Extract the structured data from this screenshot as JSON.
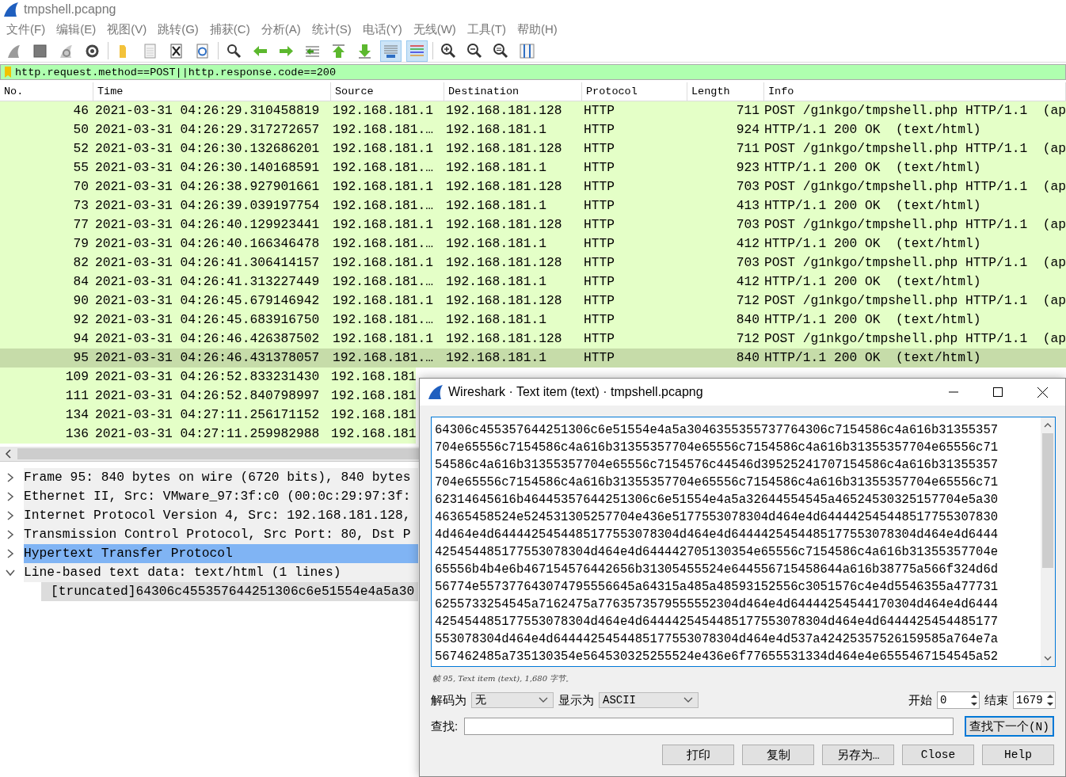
{
  "window": {
    "title": "tmpshell.pcapng"
  },
  "menu": [
    "文件(F)",
    "编辑(E)",
    "视图(V)",
    "跳转(G)",
    "捕获(C)",
    "分析(A)",
    "统计(S)",
    "电话(Y)",
    "无线(W)",
    "工具(T)",
    "帮助(H)"
  ],
  "toolbar_groups": [
    {
      "buttons": [
        {
          "kind": "fin",
          "pressed": false
        },
        {
          "kind": "stop",
          "pressed": false
        },
        {
          "kind": "restart",
          "pressed": false
        },
        {
          "kind": "options",
          "pressed": false
        }
      ]
    },
    {
      "buttons": [
        {
          "kind": "open",
          "pressed": false
        },
        {
          "kind": "file",
          "pressed": false
        },
        {
          "kind": "close",
          "pressed": false
        },
        {
          "kind": "reload",
          "pressed": false
        }
      ]
    },
    {
      "buttons": [
        {
          "kind": "find",
          "pressed": false
        },
        {
          "kind": "back",
          "pressed": false
        },
        {
          "kind": "forward",
          "pressed": false
        },
        {
          "kind": "goto",
          "pressed": false
        },
        {
          "kind": "first",
          "pressed": false
        },
        {
          "kind": "last",
          "pressed": false
        },
        {
          "kind": "autoscroll",
          "pressed": true
        },
        {
          "kind": "colorize",
          "pressed": true
        }
      ]
    },
    {
      "buttons": [
        {
          "kind": "zoom-in",
          "pressed": false
        },
        {
          "kind": "zoom-out",
          "pressed": false
        },
        {
          "kind": "zoom-normal",
          "pressed": false
        },
        {
          "kind": "resize",
          "pressed": false
        }
      ]
    }
  ],
  "filter": {
    "value": "http.request.method==POST||http.response.code==200"
  },
  "packet_list": {
    "columns": [
      "No.",
      "Time",
      "Source",
      "Destination",
      "Protocol",
      "Length",
      "Info"
    ],
    "rows": [
      {
        "cells": [
          "46",
          "2021-03-31 04:26:29.310458819",
          "192.168.181.1",
          "192.168.181.128",
          "HTTP",
          "711",
          "POST /g1nkgo/tmpshell.php HTTP/1.1  (ap"
        ],
        "selected": false
      },
      {
        "cells": [
          "50",
          "2021-03-31 04:26:29.317272657",
          "192.168.181.…",
          "192.168.181.1",
          "HTTP",
          "924",
          "HTTP/1.1 200 OK  (text/html)"
        ],
        "selected": false
      },
      {
        "cells": [
          "52",
          "2021-03-31 04:26:30.132686201",
          "192.168.181.1",
          "192.168.181.128",
          "HTTP",
          "711",
          "POST /g1nkgo/tmpshell.php HTTP/1.1  (ap"
        ],
        "selected": false
      },
      {
        "cells": [
          "55",
          "2021-03-31 04:26:30.140168591",
          "192.168.181.…",
          "192.168.181.1",
          "HTTP",
          "923",
          "HTTP/1.1 200 OK  (text/html)"
        ],
        "selected": false
      },
      {
        "cells": [
          "70",
          "2021-03-31 04:26:38.927901661",
          "192.168.181.1",
          "192.168.181.128",
          "HTTP",
          "703",
          "POST /g1nkgo/tmpshell.php HTTP/1.1  (ap"
        ],
        "selected": false
      },
      {
        "cells": [
          "73",
          "2021-03-31 04:26:39.039197754",
          "192.168.181.…",
          "192.168.181.1",
          "HTTP",
          "413",
          "HTTP/1.1 200 OK  (text/html)"
        ],
        "selected": false
      },
      {
        "cells": [
          "77",
          "2021-03-31 04:26:40.129923441",
          "192.168.181.1",
          "192.168.181.128",
          "HTTP",
          "703",
          "POST /g1nkgo/tmpshell.php HTTP/1.1  (ap"
        ],
        "selected": false
      },
      {
        "cells": [
          "79",
          "2021-03-31 04:26:40.166346478",
          "192.168.181.…",
          "192.168.181.1",
          "HTTP",
          "412",
          "HTTP/1.1 200 OK  (text/html)"
        ],
        "selected": false
      },
      {
        "cells": [
          "82",
          "2021-03-31 04:26:41.306414157",
          "192.168.181.1",
          "192.168.181.128",
          "HTTP",
          "703",
          "POST /g1nkgo/tmpshell.php HTTP/1.1  (ap"
        ],
        "selected": false
      },
      {
        "cells": [
          "84",
          "2021-03-31 04:26:41.313227449",
          "192.168.181.…",
          "192.168.181.1",
          "HTTP",
          "412",
          "HTTP/1.1 200 OK  (text/html)"
        ],
        "selected": false
      },
      {
        "cells": [
          "90",
          "2021-03-31 04:26:45.679146942",
          "192.168.181.1",
          "192.168.181.128",
          "HTTP",
          "712",
          "POST /g1nkgo/tmpshell.php HTTP/1.1  (ap"
        ],
        "selected": false
      },
      {
        "cells": [
          "92",
          "2021-03-31 04:26:45.683916750",
          "192.168.181.…",
          "192.168.181.1",
          "HTTP",
          "840",
          "HTTP/1.1 200 OK  (text/html)"
        ],
        "selected": false
      },
      {
        "cells": [
          "94",
          "2021-03-31 04:26:46.426387502",
          "192.168.181.1",
          "192.168.181.128",
          "HTTP",
          "712",
          "POST /g1nkgo/tmpshell.php HTTP/1.1  (ap"
        ],
        "selected": false
      },
      {
        "cells": [
          "95",
          "2021-03-31 04:26:46.431378057",
          "192.168.181.…",
          "192.168.181.1",
          "HTTP",
          "840",
          "HTTP/1.1 200 OK  (text/html)"
        ],
        "selected": true
      },
      {
        "cells": [
          "109",
          "2021-03-31 04:26:52.833231430",
          "192.168.181"
        ],
        "selected": false
      },
      {
        "cells": [
          "111",
          "2021-03-31 04:26:52.840798997",
          "192.168.181"
        ],
        "selected": false
      },
      {
        "cells": [
          "134",
          "2021-03-31 04:27:11.256171152",
          "192.168.181"
        ],
        "selected": false
      },
      {
        "cells": [
          "136",
          "2021-03-31 04:27:11.259982988",
          "192.168.181"
        ],
        "selected": false
      }
    ]
  },
  "details": [
    {
      "text": "Frame 95: 840 bytes on wire (6720 bits), 840 bytes",
      "expanded": false,
      "selected": false
    },
    {
      "text": "Ethernet II, Src: VMware_97:3f:c0 (00:0c:29:97:3f:",
      "expanded": false,
      "selected": false
    },
    {
      "text": "Internet Protocol Version 4, Src: 192.168.181.128,",
      "expanded": false,
      "selected": false
    },
    {
      "text": "Transmission Control Protocol, Src Port: 80, Dst P",
      "expanded": false,
      "selected": false
    },
    {
      "text": "Hypertext Transfer Protocol",
      "expanded": false,
      "selected": true
    },
    {
      "text": "Line-based text data: text/html (1 lines)",
      "expanded": true,
      "selected": false,
      "children": [
        {
          "text": "[truncated]64306c455357644251306c6e51554e4a5a30",
          "selected": false
        }
      ]
    }
  ],
  "dialog": {
    "title": "Wireshark · Text item (text) · tmpshell.pcapng",
    "text_lines": [
      "64306c455357644251306c6e51554e4a5a3046355355737764306c7154586c4a616b31355357",
      "704e65556c7154586c4a616b31355357704e65556c7154586c4a616b31355357704e65556c71",
      "54586c4a616b31355357704e65556c7154576c44546d39525241707154586c4a616b31355357",
      "704e65556c7154586c4a616b31355357704e65556c7154586c4a616b31355357704e65556c71",
      "62314645616b46445357644251306c6e51554e4a5a32644554545a46524530325157704e5a30",
      "46365458524e524531305257704e436e5177553078304d464e4d644442545448517755307830",
      "4d464e4d6444425454485177553078304d464e4d6444425454485177553078304d464e4d6444",
      "425454485177553078304d464e4d644442705130354e65556c7154586c4a616b31355357704e",
      "65556b4b4e6b467154576442656b31305455524e644556715458644a616b38775a566f324d6d",
      "56774e557377643074795556645a64315a485a48593152556c3051576c4e4d5546355a477731",
      "6255733254545a7162475a7763573579555552304d464e4d64444254544170304d464e4d6444",
      "425454485177553078304d464e4d6444425454485177553078304d464e4d6444425454485177",
      "553078304d464e4d6444425454485177553078304d464e4d537a42425357526159585a764e7a",
      "567462485a735130354e564530325255524e436e6f77655531334d464e4e6555467154545a52"
    ],
    "status": "帧 95, Text item (text), 1,680 字节。",
    "decode_label": "解码为",
    "decode_value": "无",
    "show_label": "显示为",
    "show_value": "ASCII",
    "start_label": "开始",
    "start_value": "0",
    "end_label": "结束",
    "end_value": "1679",
    "find_label": "查找:",
    "find_button": "查找下一个(N)",
    "buttons": [
      "打印",
      "复制",
      "另存为…",
      "Close",
      "Help"
    ]
  }
}
